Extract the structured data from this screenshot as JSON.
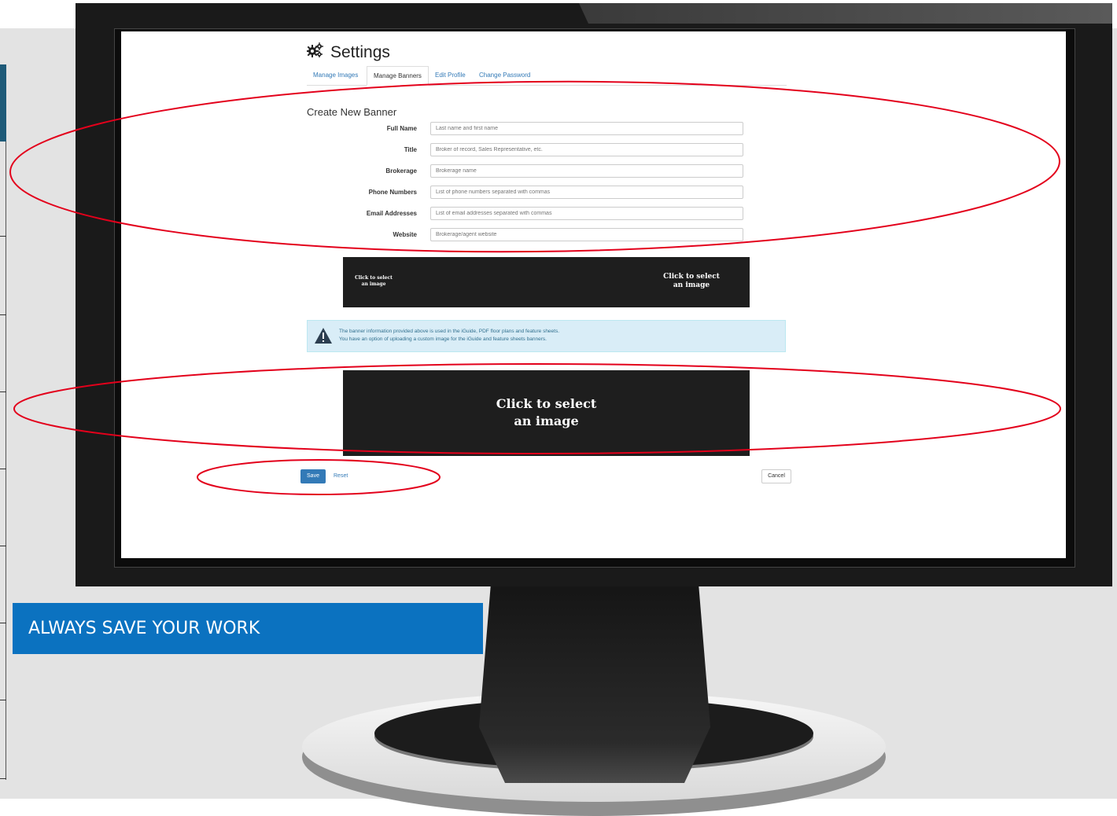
{
  "callout": {
    "text": "ALWAYS SAVE YOUR WORK"
  },
  "settings": {
    "title": "Settings",
    "icon": "gears-icon",
    "tabs": [
      {
        "label": "Manage Images",
        "active": false
      },
      {
        "label": "Manage Banners",
        "active": true
      },
      {
        "label": "Edit Profile",
        "active": false
      },
      {
        "label": "Change Password",
        "active": false
      }
    ]
  },
  "form": {
    "section_title": "Create New Banner",
    "fields": [
      {
        "label": "Full Name",
        "placeholder": "Last name and first name",
        "value": ""
      },
      {
        "label": "Title",
        "placeholder": "Broker of record, Sales Representative, etc.",
        "value": ""
      },
      {
        "label": "Brokerage",
        "placeholder": "Brokerage name",
        "value": ""
      },
      {
        "label": "Phone Numbers",
        "placeholder": "List of phone numbers separated with commas",
        "value": ""
      },
      {
        "label": "Email Addresses",
        "placeholder": "List of email addresses separated with commas",
        "value": ""
      },
      {
        "label": "Website",
        "placeholder": "Brokerage/agent website",
        "value": ""
      }
    ]
  },
  "banner_small": {
    "left_text": "Click to select an image",
    "right_text": "Click to select an image"
  },
  "info": {
    "line1": "The banner information provided above is used in the iGuide, PDF floor plans and feature sheets.",
    "line2": "You have an option of uploading a custom image for the iGuide and feature sheets banners.",
    "icon": "warning-icon"
  },
  "banner_big": {
    "text": "Click to select an image"
  },
  "actions": {
    "save": "Save",
    "reset": "Reset",
    "cancel": "Cancel"
  },
  "colors": {
    "accent": "#337ab7",
    "callout": "#0b72c0",
    "annotation": "#e3001b"
  }
}
